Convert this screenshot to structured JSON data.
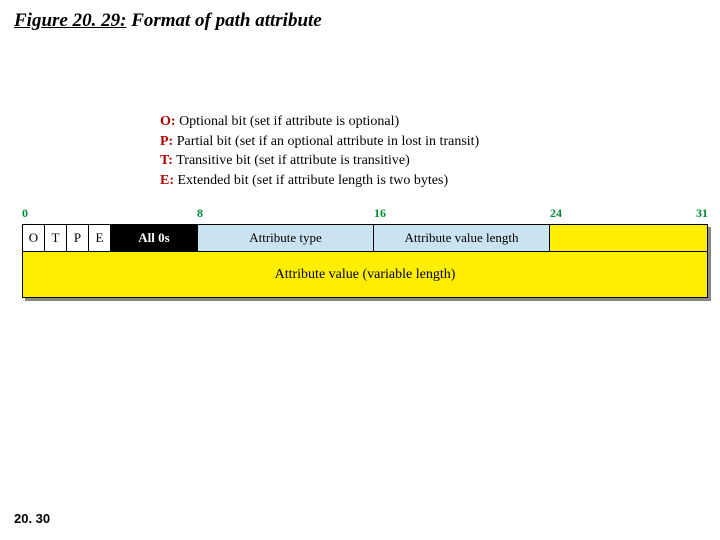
{
  "title": {
    "figref": "Figure 20. 29:",
    "caption": "Format of path attribute"
  },
  "legend": [
    {
      "key": "O:",
      "desc": "Optional bit (set if attribute is optional)"
    },
    {
      "key": "P:",
      "desc": "Partial bit (set if an optional attribute in lost in transit)"
    },
    {
      "key": "T:",
      "desc": "Transitive bit (set if attribute is transitive)"
    },
    {
      "key": "E:",
      "desc": "Extended bit (set if attribute length is two bytes)"
    }
  ],
  "bits": {
    "b0": "0",
    "b8": "8",
    "b16": "16",
    "b24": "24",
    "b31": "31"
  },
  "fields": {
    "flag_o": "O",
    "flag_t": "T",
    "flag_p": "P",
    "flag_e": "E",
    "all_zeros": "All 0s",
    "attr_type": "Attribute type",
    "attr_len": "Attribute value length",
    "attr_val": "Attribute value (variable length)"
  },
  "page": "20. 30"
}
